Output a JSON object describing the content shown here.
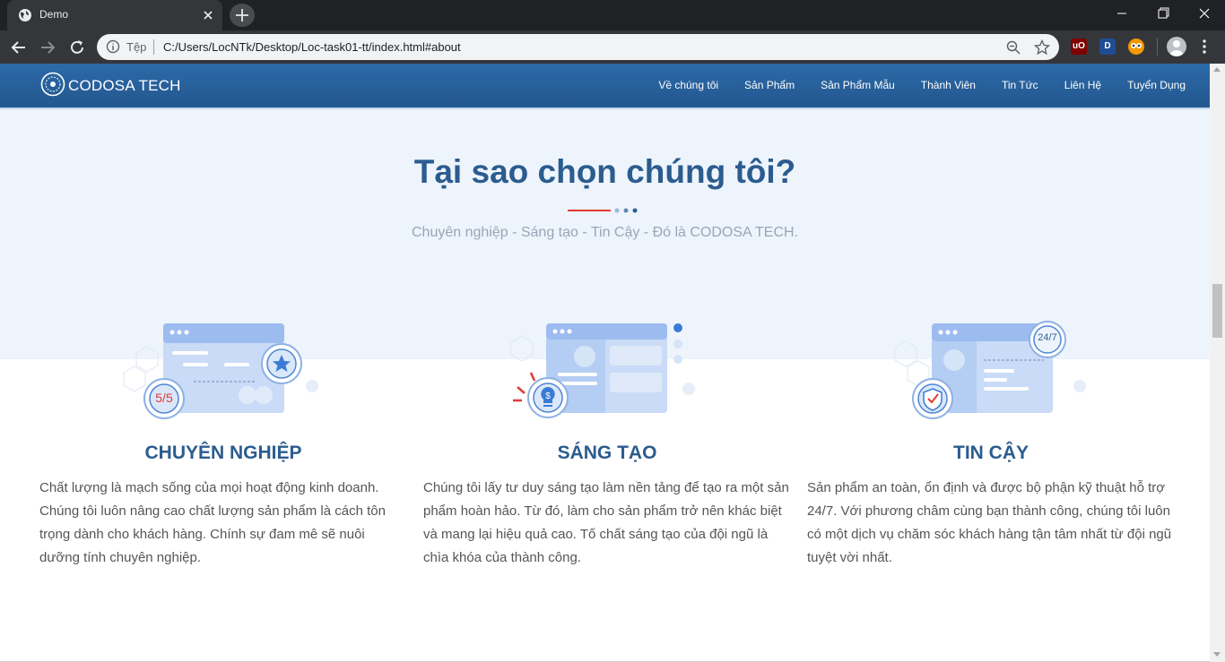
{
  "browser": {
    "tab_title": "Demo",
    "scheme_label": "Tệp",
    "url": "C:/Users/LocNTk/Desktop/Loc-task01-tt/index.html#about",
    "extensions": [
      {
        "icon": "ublock-origin-icon",
        "label": "uO",
        "color": "#800000"
      },
      {
        "icon": "dashlane-icon",
        "label": "D",
        "color": "#1f4c94"
      },
      {
        "icon": "owl-extension-icon",
        "label": "",
        "color": "#f29900"
      }
    ]
  },
  "site": {
    "logo_text": "CODOSA TECH",
    "nav": [
      "Về chúng tôi",
      "Sản Phẩm",
      "Sản Phẩm Mẫu",
      "Thành Viên",
      "Tin Tức",
      "Liên Hệ",
      "Tuyển Dụng"
    ]
  },
  "section": {
    "heading": "Tại sao chọn chúng tôi?",
    "tagline": "Chuyên nghiệp - Sáng tạo - Tin Cậy - Đó là CODOSA TECH.",
    "features": [
      {
        "title": "CHUYÊN NGHIỆP",
        "badge": "5/5",
        "icon": "star-badge-icon",
        "text": "Chất lượng là mạch sống của mọi hoạt động kinh doanh. Chúng tôi luôn nâng cao chất lượng sản phẩm là cách tôn trọng dành cho khách hàng. Chính sự đam mê sẽ nuôi dưỡng tính chuyên nghiệp."
      },
      {
        "title": "SÁNG TẠO",
        "badge": "",
        "icon": "lightbulb-dollar-icon",
        "text": "Chúng tôi lấy tư duy sáng tạo làm nền tảng để tạo ra một sản phẩm hoàn hảo. Từ đó, làm cho sản phẩm trở nên khác biệt và mang lại hiệu quả cao. Tố chất sáng tạo của đội ngũ là chìa khóa của thành công."
      },
      {
        "title": "TIN CẬY",
        "badge": "24/7",
        "icon": "shield-check-icon",
        "text": "Sản phẩm an toàn, ổn định và được bộ phận kỹ thuật hỗ trợ 24/7. Với phương châm cùng bạn thành công, chúng tôi luôn có một dịch vụ chăm sóc khách hàng tận tâm nhất từ đội ngũ tuyệt vời nhất."
      }
    ]
  },
  "colors": {
    "accent_blue": "#2b5c8f",
    "accent_red": "#e53935",
    "section_bg": "#eef4fc"
  }
}
